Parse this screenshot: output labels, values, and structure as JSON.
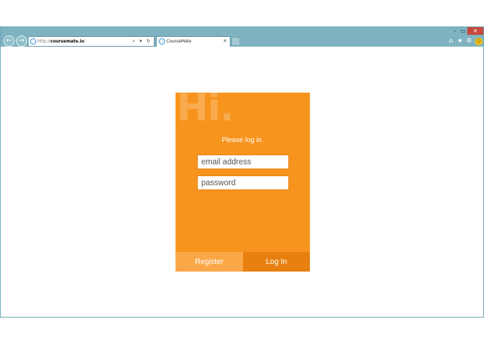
{
  "browser": {
    "url_proto": "http://",
    "url_host": "coursemate.io",
    "url_path": "/",
    "address_tools": "⌕ ▾ ↻",
    "tab_title": "CourseMate",
    "tab_close": "✕",
    "back_icon": "arrow-left-icon",
    "forward_icon": "arrow-right-icon",
    "home_icon": "home-icon",
    "favorites_icon": "star-icon",
    "tools_icon": "gear-icon",
    "feedback_icon": "smiley-icon",
    "window_controls": {
      "minimize": "–",
      "maximize": "▭",
      "close": "✕"
    },
    "chrome_color": "#7fb3c1"
  },
  "login": {
    "watermark": "Hi.",
    "prompt": "Please log in.",
    "email_placeholder": "email address",
    "password_placeholder": "password",
    "register_label": "Register",
    "login_label": "Log In",
    "accent_color": "#f7941d"
  }
}
